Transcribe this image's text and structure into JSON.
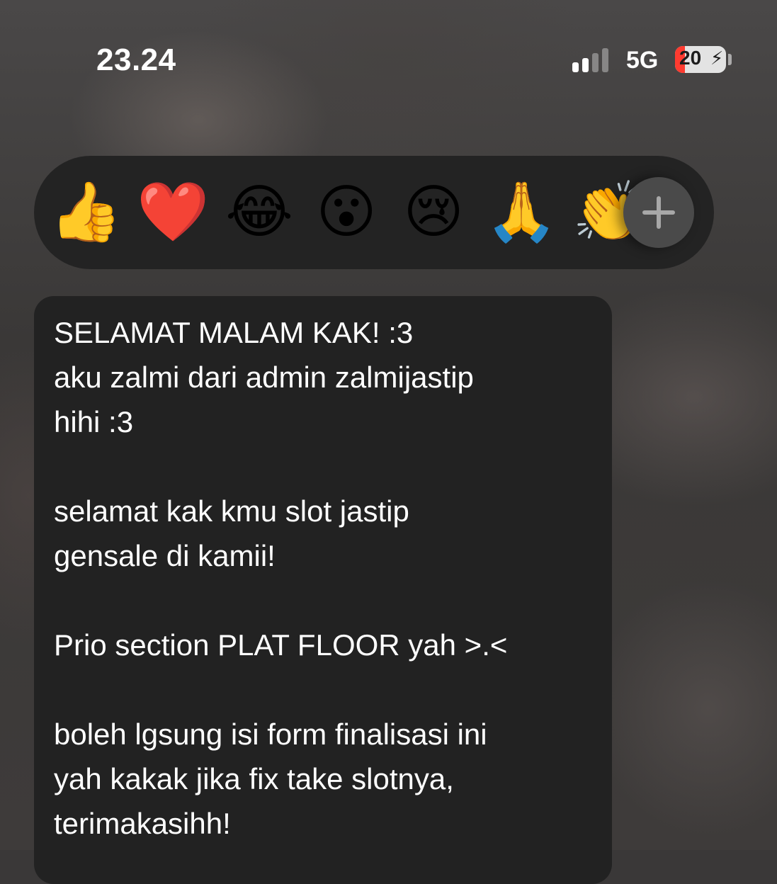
{
  "status_bar": {
    "time": "23.24",
    "network": "5G",
    "battery_percent": "20",
    "battery_level": 0.2,
    "battery_charging_icon": "bolt-icon",
    "signal_bars_active": 2,
    "signal_bars_total": 4
  },
  "reactions": {
    "emojis": [
      {
        "name": "thumbs-up-emoji",
        "glyph": "👍"
      },
      {
        "name": "red-heart-emoji",
        "glyph": "❤️"
      },
      {
        "name": "tears-of-joy-emoji",
        "glyph": "😂"
      },
      {
        "name": "surprised-emoji",
        "glyph": "😮"
      },
      {
        "name": "crying-emoji",
        "glyph": "😢"
      },
      {
        "name": "folded-hands-emoji",
        "glyph": "🙏"
      },
      {
        "name": "clapping-hands-emoji",
        "glyph": "👏"
      }
    ],
    "more_icon": "plus-icon"
  },
  "message": {
    "lines": [
      "SELAMAT MALAM KAK! :3",
      "aku zalmi dari admin zalmijastip",
      "hihi :3",
      "",
      "selamat kak kmu slot jastip",
      "gensale di kamii!",
      "",
      "Prio section PLAT FLOOR yah >.<",
      "",
      "boleh lgsung isi form finalisasi ini",
      "yah kakak jika fix take slotnya,",
      "terimakasihh!"
    ]
  },
  "colors": {
    "bubble": "#222222",
    "reaction_bar": "#232323",
    "battery_low": "#ff3b30",
    "text": "#ffffff"
  }
}
